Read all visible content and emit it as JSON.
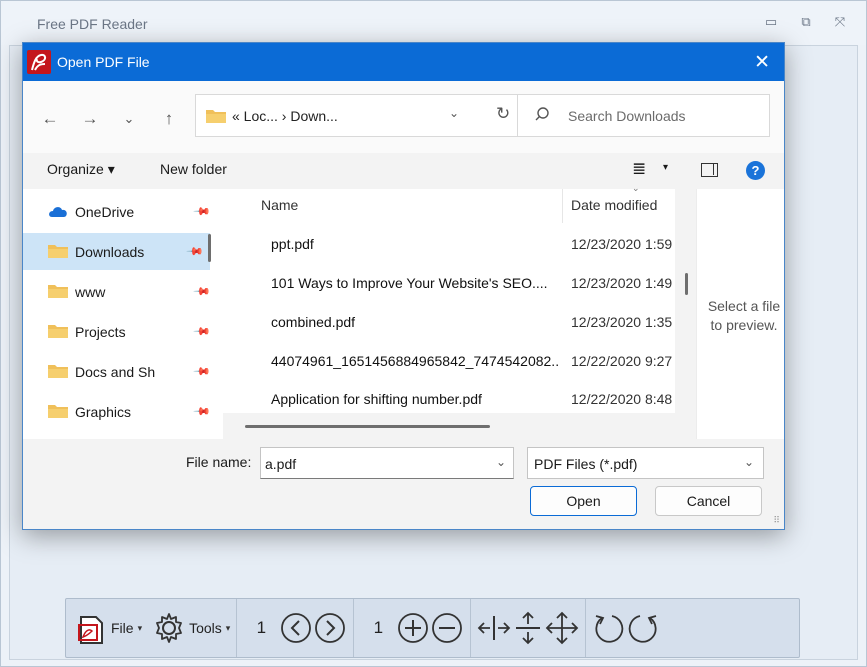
{
  "app": {
    "title": "Free PDF Reader",
    "controls": {
      "minimize": "▭",
      "restore": "⧉",
      "close": "⤧"
    }
  },
  "dialog": {
    "title": "Open PDF File",
    "close": "✕",
    "nav": {
      "back": "←",
      "forward": "→",
      "recent": "⌄",
      "up": "↑"
    },
    "address": {
      "path": "« Loc... › Down...",
      "chevron": "⌄",
      "refresh": "↻"
    },
    "search": {
      "placeholder": "Search Downloads"
    },
    "commands": {
      "organize": "Organize ▾",
      "new_folder": "New folder",
      "view": "≣",
      "view_caret": "▾",
      "help": "?"
    },
    "sidebar": {
      "items": [
        {
          "label": "OneDrive"
        },
        {
          "label": "Downloads"
        },
        {
          "label": "www"
        },
        {
          "label": "Projects"
        },
        {
          "label": "Docs and Sh"
        },
        {
          "label": "Graphics"
        }
      ],
      "pin": "📌"
    },
    "columns": {
      "name": "Name",
      "date": "Date modified"
    },
    "files": [
      {
        "name": "ppt.pdf",
        "date": "12/23/2020 1:59"
      },
      {
        "name": "101 Ways to Improve Your Website's SEO....",
        "date": "12/23/2020 1:49"
      },
      {
        "name": "combined.pdf",
        "date": "12/23/2020 1:35"
      },
      {
        "name": "44074961_1651456884965842_7474542082...",
        "date": "12/22/2020 9:27"
      },
      {
        "name": "Application for shifting number.pdf",
        "date": "12/22/2020 8:48"
      }
    ],
    "preview_text": "Select a file to preview.",
    "file_name": {
      "label": "File name:",
      "value": "a.pdf",
      "chevron": "⌄"
    },
    "file_type": {
      "value": "PDF Files (*.pdf)",
      "chevron": "⌄"
    },
    "buttons": {
      "open": "Open",
      "cancel": "Cancel"
    }
  },
  "toolbar": {
    "file_label": "File",
    "tools_label": "Tools",
    "caret": "▾",
    "page_number": "1",
    "zoom_number": "1"
  },
  "colors": {
    "accent": "#0b6bd6",
    "selection": "#cde4f7",
    "folder": "#f0c05a",
    "logo": "#c4161c"
  }
}
